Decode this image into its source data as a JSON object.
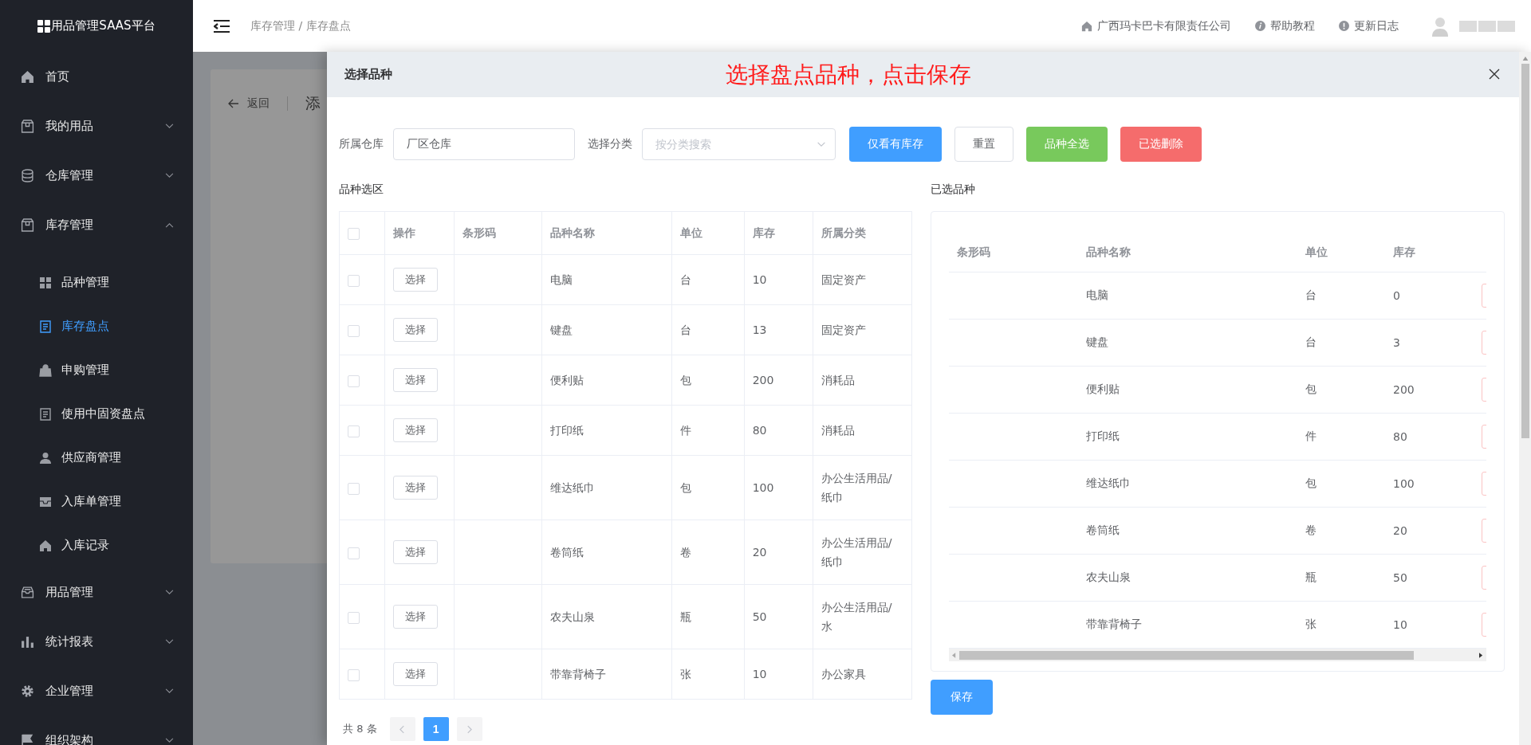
{
  "sidebar": {
    "logo": "用品管理SAAS平台",
    "items": [
      {
        "label": "首页"
      },
      {
        "label": "我的用品",
        "expanded": false
      },
      {
        "label": "仓库管理",
        "expanded": false
      },
      {
        "label": "库存管理",
        "expanded": true,
        "children": [
          {
            "label": "品种管理",
            "selected": false
          },
          {
            "label": "库存盘点",
            "selected": true
          },
          {
            "label": "申购管理",
            "selected": false
          },
          {
            "label": "使用中固资盘点",
            "selected": false
          },
          {
            "label": "供应商管理",
            "selected": false
          },
          {
            "label": "入库单管理",
            "selected": false
          },
          {
            "label": "入库记录",
            "selected": false
          }
        ]
      },
      {
        "label": "用品管理",
        "expanded": false
      },
      {
        "label": "统计报表",
        "expanded": false
      },
      {
        "label": "企业管理",
        "expanded": false
      },
      {
        "label": "组织架构",
        "expanded": false
      }
    ]
  },
  "header": {
    "breadcrumb": "库存管理 / 库存盘点",
    "links": [
      "广西玛卡巴卡有限责任公司",
      "帮助教程",
      "更新日志"
    ]
  },
  "background_page": {
    "back": "返回",
    "title": "添"
  },
  "dialog": {
    "title": "选择品种",
    "annotation": "选择盘点品种，点击保存",
    "filters": {
      "warehouse_label": "所属仓库",
      "warehouse_value": "厂区仓库",
      "category_label": "选择分类",
      "category_placeholder": "按分类搜索"
    },
    "buttons": [
      {
        "label": "仅看有库存",
        "kind": "primary"
      },
      {
        "label": "重置",
        "kind": "default"
      },
      {
        "label": "品种全选",
        "kind": "success"
      },
      {
        "label": "已选删除",
        "kind": "danger"
      }
    ],
    "left_table": {
      "title": "品种选区",
      "all_checked": false,
      "columns": [
        "操作",
        "条形码",
        "品种名称",
        "单位",
        "库存",
        "所属分类"
      ],
      "rows": [
        {
          "checked": false,
          "action": "选择",
          "name": "电脑",
          "unit": "台",
          "stock": "10",
          "category": "固定资产"
        },
        {
          "checked": false,
          "action": "选择",
          "name": "键盘",
          "unit": "台",
          "stock": "13",
          "category": "固定资产"
        },
        {
          "checked": false,
          "action": "选择",
          "name": "便利贴",
          "unit": "包",
          "stock": "200",
          "category": "消耗品"
        },
        {
          "checked": false,
          "action": "选择",
          "name": "打印纸",
          "unit": "件",
          "stock": "80",
          "category": "消耗品"
        },
        {
          "checked": false,
          "action": "选择",
          "name": "维达纸巾",
          "unit": "包",
          "stock": "100",
          "category": "办公生活用品/纸巾"
        },
        {
          "checked": false,
          "action": "选择",
          "name": "卷筒纸",
          "unit": "卷",
          "stock": "20",
          "category": "办公生活用品/纸巾"
        },
        {
          "checked": false,
          "action": "选择",
          "name": "农夫山泉",
          "unit": "瓶",
          "stock": "50",
          "category": "办公生活用品/水"
        },
        {
          "checked": false,
          "action": "选择",
          "name": "带靠背椅子",
          "unit": "张",
          "stock": "10",
          "category": "办公家具"
        }
      ]
    },
    "pagination": {
      "total": "共 8 条",
      "pages": [
        {
          "label": "1",
          "selected": true
        }
      ]
    },
    "right_table": {
      "title": "已选品种",
      "columns": [
        "条形码",
        "品种名称",
        "单位",
        "库存"
      ],
      "rows": [
        {
          "name": "电脑",
          "unit": "台",
          "stock": "0"
        },
        {
          "name": "键盘",
          "unit": "台",
          "stock": "3"
        },
        {
          "name": "便利贴",
          "unit": "包",
          "stock": "200"
        },
        {
          "name": "打印纸",
          "unit": "件",
          "stock": "80"
        },
        {
          "name": "维达纸巾",
          "unit": "包",
          "stock": "100"
        },
        {
          "name": "卷筒纸",
          "unit": "卷",
          "stock": "20"
        },
        {
          "name": "农夫山泉",
          "unit": "瓶",
          "stock": "50"
        },
        {
          "name": "带靠背椅子",
          "unit": "张",
          "stock": "10"
        }
      ]
    },
    "save": "保存"
  }
}
